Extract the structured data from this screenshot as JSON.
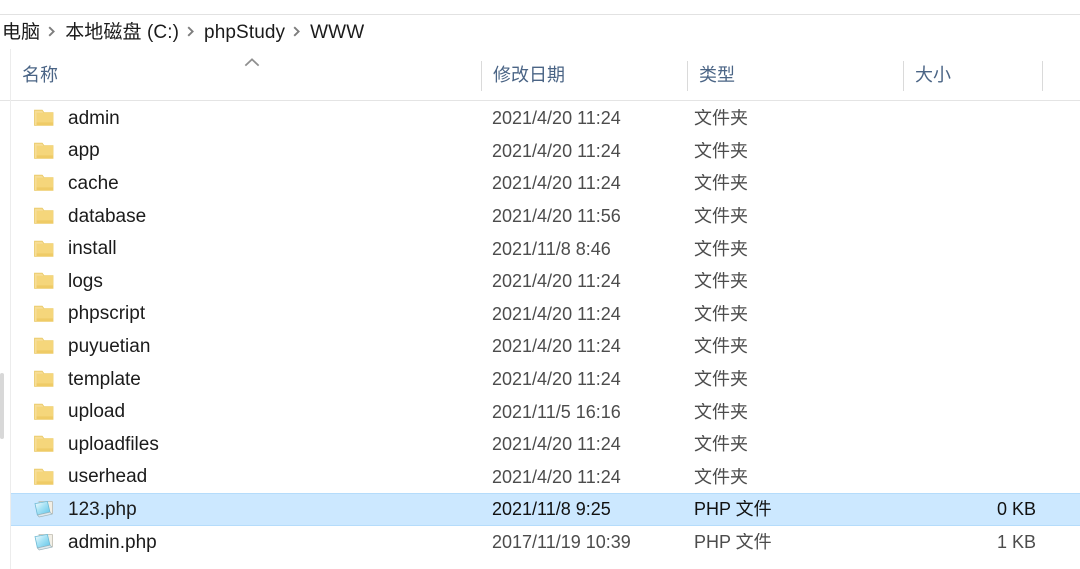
{
  "window": {
    "title": "WWW"
  },
  "breadcrumb": {
    "name": "address-bar",
    "separator": "›",
    "items": [
      {
        "label": "电脑"
      },
      {
        "label": "本地磁盘 (C:)"
      },
      {
        "label": "phpStudy"
      },
      {
        "label": "WWW"
      }
    ]
  },
  "columns": {
    "name": "名称",
    "date": "修改日期",
    "type": "类型",
    "size": "大小",
    "sort": {
      "column": "名称",
      "direction": "ascending",
      "glyph": "chevron-up"
    }
  },
  "colors": {
    "selection_fill": "#cce8ff",
    "selection_border": "#b5dcfb",
    "header_text": "#4a6485",
    "folder_icon": "#f5d67b",
    "php_icon": "#7fd3ef"
  },
  "files": [
    {
      "name": "admin",
      "date": "2021/4/20 11:24",
      "type": "文件夹",
      "size": "",
      "icon": "folder-icon",
      "selected": false
    },
    {
      "name": "app",
      "date": "2021/4/20 11:24",
      "type": "文件夹",
      "size": "",
      "icon": "folder-icon",
      "selected": false
    },
    {
      "name": "cache",
      "date": "2021/4/20 11:24",
      "type": "文件夹",
      "size": "",
      "icon": "folder-icon",
      "selected": false
    },
    {
      "name": "database",
      "date": "2021/4/20 11:56",
      "type": "文件夹",
      "size": "",
      "icon": "folder-icon",
      "selected": false
    },
    {
      "name": "install",
      "date": "2021/11/8 8:46",
      "type": "文件夹",
      "size": "",
      "icon": "folder-icon",
      "selected": false
    },
    {
      "name": "logs",
      "date": "2021/4/20 11:24",
      "type": "文件夹",
      "size": "",
      "icon": "folder-icon",
      "selected": false
    },
    {
      "name": "phpscript",
      "date": "2021/4/20 11:24",
      "type": "文件夹",
      "size": "",
      "icon": "folder-icon",
      "selected": false
    },
    {
      "name": "puyuetian",
      "date": "2021/4/20 11:24",
      "type": "文件夹",
      "size": "",
      "icon": "folder-icon",
      "selected": false
    },
    {
      "name": "template",
      "date": "2021/4/20 11:24",
      "type": "文件夹",
      "size": "",
      "icon": "folder-icon",
      "selected": false
    },
    {
      "name": "upload",
      "date": "2021/11/5 16:16",
      "type": "文件夹",
      "size": "",
      "icon": "folder-icon",
      "selected": false
    },
    {
      "name": "uploadfiles",
      "date": "2021/4/20 11:24",
      "type": "文件夹",
      "size": "",
      "icon": "folder-icon",
      "selected": false
    },
    {
      "name": "userhead",
      "date": "2021/4/20 11:24",
      "type": "文件夹",
      "size": "",
      "icon": "folder-icon",
      "selected": false
    },
    {
      "name": "123.php",
      "date": "2021/11/8 9:25",
      "type": "PHP 文件",
      "size": "0 KB",
      "icon": "php-file-icon",
      "selected": true
    },
    {
      "name": "admin.php",
      "date": "2017/11/19 10:39",
      "type": "PHP 文件",
      "size": "1 KB",
      "icon": "php-file-icon",
      "selected": false
    }
  ]
}
